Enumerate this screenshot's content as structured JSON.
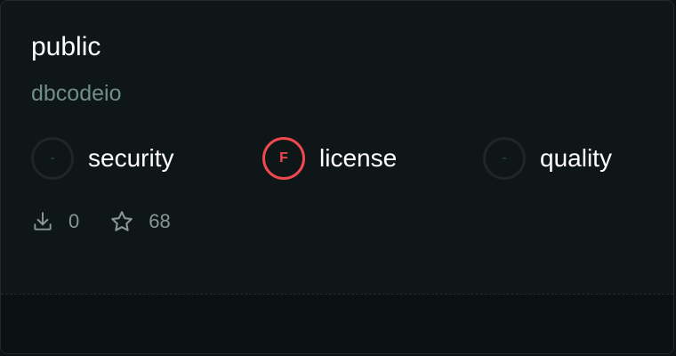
{
  "package": {
    "name": "public",
    "owner": "dbcodeio"
  },
  "scores": [
    {
      "label": "security",
      "grade": "-"
    },
    {
      "label": "license",
      "grade": "F"
    },
    {
      "label": "quality",
      "grade": "-"
    }
  ],
  "stats": {
    "downloads": "0",
    "stars": "68"
  },
  "colors": {
    "accent_bad": "#f0484f",
    "owner_text": "#6f8f85",
    "background": "#0f1617"
  },
  "icons": {
    "downloads": "download-icon",
    "stars": "star-icon"
  }
}
